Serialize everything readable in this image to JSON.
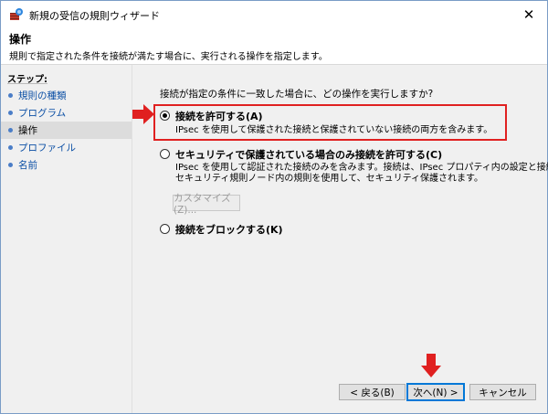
{
  "window": {
    "title": "新規の受信の規則ウィザード",
    "close_glyph": "✕"
  },
  "header": {
    "title": "操作",
    "description": "規則で指定された条件を接続が満たす場合に、実行される操作を指定します。"
  },
  "sidebar": {
    "title": "ステップ:",
    "items": [
      {
        "label": "規則の種類"
      },
      {
        "label": "プログラム"
      },
      {
        "label": "操作"
      },
      {
        "label": "プロファイル"
      },
      {
        "label": "名前"
      }
    ]
  },
  "main": {
    "question": "接続が指定の条件に一致した場合に、どの操作を実行しますか?",
    "options": [
      {
        "label": "接続を許可する(A)",
        "description": "IPsec を使用して保護された接続と保護されていない接続の両方を含みます。",
        "selected": true
      },
      {
        "label": "セキュリティで保護されている場合のみ接続を許可する(C)",
        "description_line1": "IPsec を使用して認証された接続のみを含みます。接続は、IPsec プロパティ内の設定と接続",
        "description_line2": "セキュリティ規則ノード内の規則を使用して、セキュリティ保護されます。",
        "selected": false
      },
      {
        "label": "接続をブロックする(K)",
        "selected": false
      }
    ],
    "customize_button": "カスタマイズ(Z)..."
  },
  "footer": {
    "back_button": "< 戻る(B)",
    "next_button": "次へ(N) >",
    "cancel_button": "キャンセル"
  },
  "colors": {
    "accent": "#0078d7",
    "annotation_red": "#e02020",
    "link_blue": "#0b4fa5"
  },
  "icons": {
    "app": "firewall-icon",
    "close": "close-icon",
    "step_bullet": "bullet-icon",
    "annotation_right": "red-arrow-right-icon",
    "annotation_down": "red-arrow-down-icon"
  }
}
